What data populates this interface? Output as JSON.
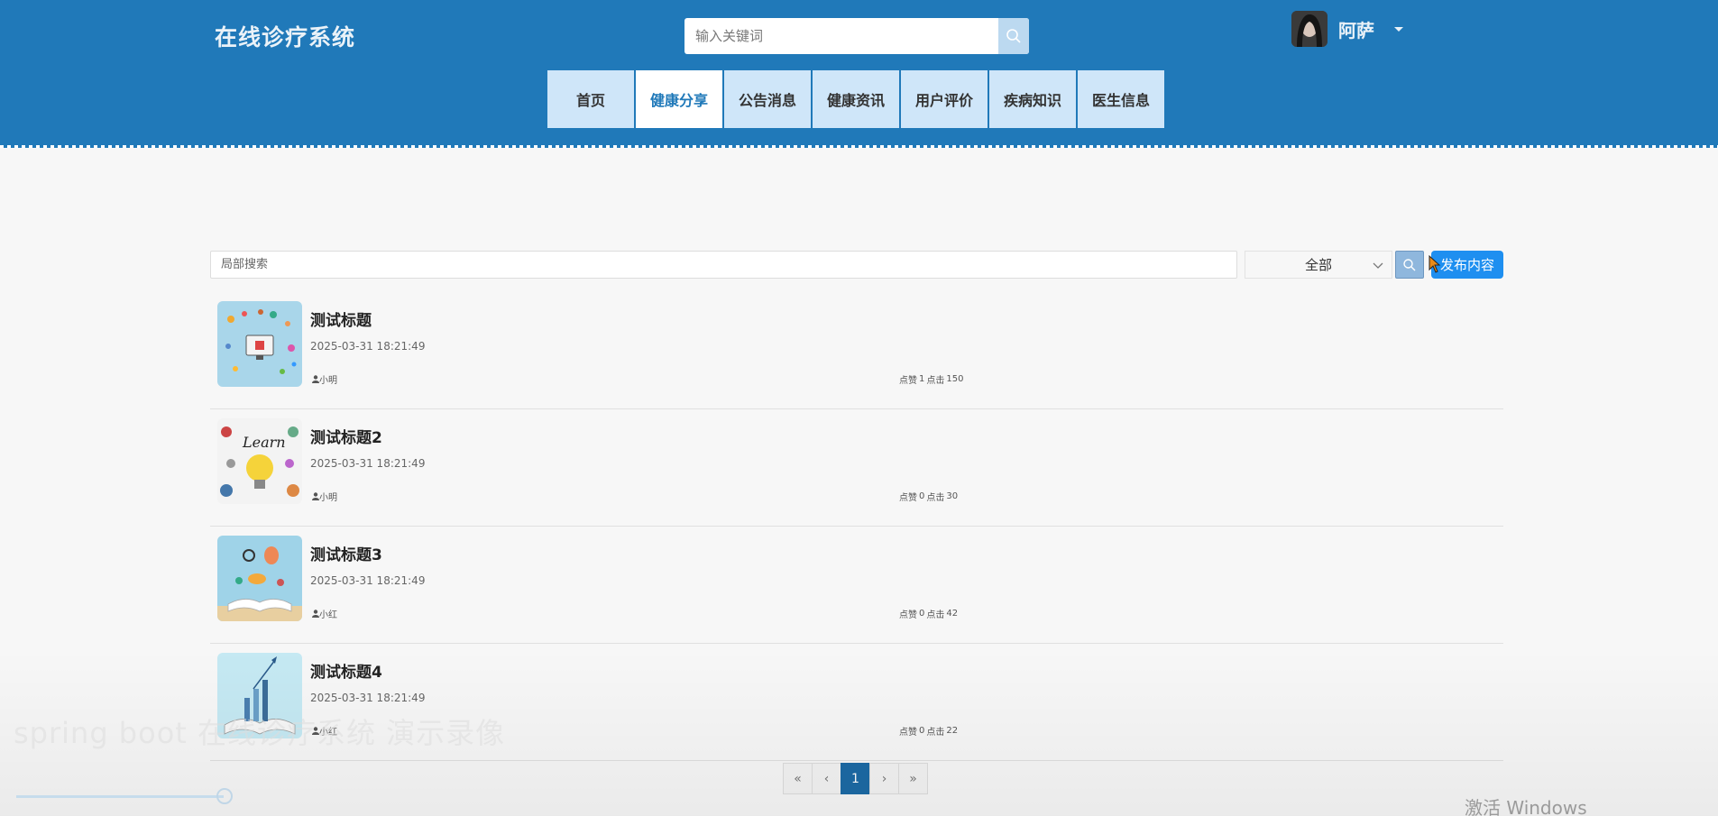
{
  "header": {
    "logo": "在线诊疗系统",
    "search_placeholder": "输入关键词",
    "username": "阿萨"
  },
  "nav": {
    "items": [
      "首页",
      "健康分享",
      "公告消息",
      "健康资讯",
      "用户评价",
      "疾病知识",
      "医生信息"
    ],
    "active_index": 1
  },
  "filters": {
    "local_search_placeholder": "局部搜索",
    "category_selected": "全部",
    "publish_label": "发布内容"
  },
  "posts": [
    {
      "title": "测试标题",
      "date": "2025-03-31 18:21:49",
      "author": "小明",
      "likes_label": "点赞",
      "likes": "1",
      "clicks_label": "点击",
      "clicks": "150"
    },
    {
      "title": "测试标题2",
      "date": "2025-03-31 18:21:49",
      "author": "小明",
      "likes_label": "点赞",
      "likes": "0",
      "clicks_label": "点击",
      "clicks": "30"
    },
    {
      "title": "测试标题3",
      "date": "2025-03-31 18:21:49",
      "author": "小红",
      "likes_label": "点赞",
      "likes": "0",
      "clicks_label": "点击",
      "clicks": "42"
    },
    {
      "title": "测试标题4",
      "date": "2025-03-31 18:21:49",
      "author": "小红",
      "likes_label": "点赞",
      "likes": "0",
      "clicks_label": "点击",
      "clicks": "22"
    }
  ],
  "pagination": {
    "first": "«",
    "prev": "‹",
    "current": "1",
    "next": "›",
    "last": "»"
  },
  "overlay": {
    "video_caption": "spring boot 在线诊疗系统 演示录像",
    "watermark": "激活 Windows"
  },
  "colors": {
    "header_bg": "#2079b9",
    "nav_bg": "#cfe6f9",
    "accent": "#1e8ff0"
  }
}
